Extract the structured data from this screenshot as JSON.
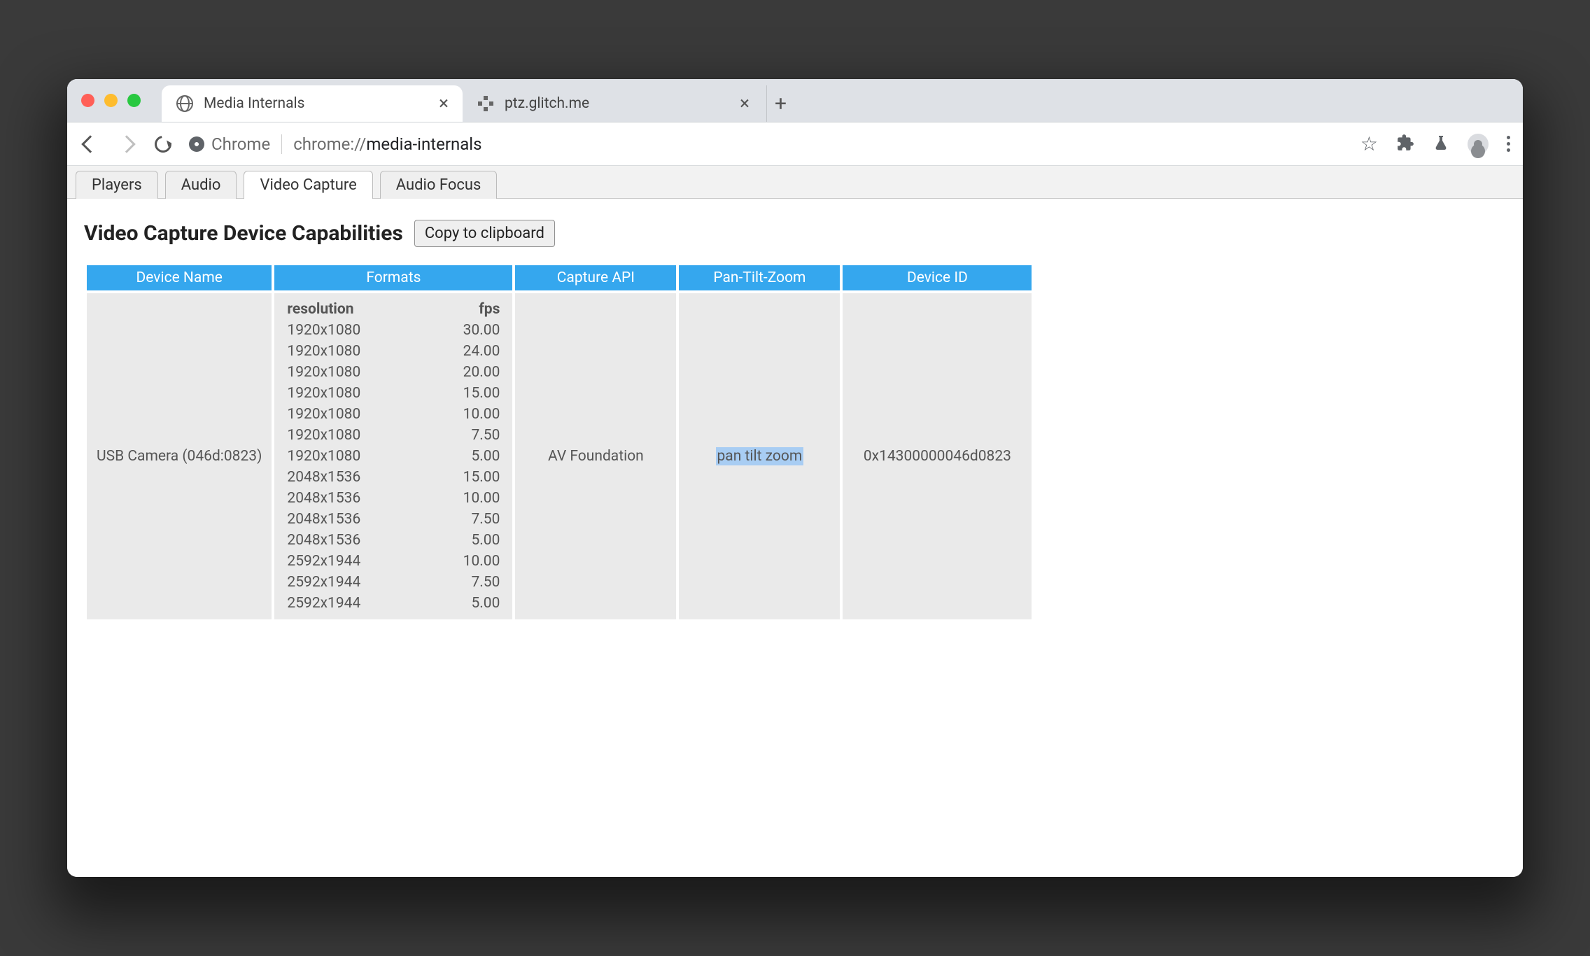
{
  "browser": {
    "tabs": [
      {
        "title": "Media Internals",
        "active": true,
        "icon": "globe"
      },
      {
        "title": "ptz.glitch.me",
        "active": false,
        "icon": "ptz"
      }
    ],
    "omnibox": {
      "origin_label": "Chrome",
      "scheme": "chrome://",
      "path": "media-internals"
    }
  },
  "page": {
    "subtabs": [
      "Players",
      "Audio",
      "Video Capture",
      "Audio Focus"
    ],
    "active_subtab": "Video Capture",
    "heading": "Video Capture Device Capabilities",
    "copy_button": "Copy to clipboard",
    "columns": [
      "Device Name",
      "Formats",
      "Capture API",
      "Pan-Tilt-Zoom",
      "Device ID"
    ],
    "device": {
      "name": "USB Camera (046d:0823)",
      "capture_api": "AV Foundation",
      "ptz": "pan tilt zoom",
      "id": "0x14300000046d0823",
      "format_headers": {
        "res": "resolution",
        "fps": "fps"
      },
      "formats": [
        {
          "res": "1920x1080",
          "fps": "30.00"
        },
        {
          "res": "1920x1080",
          "fps": "24.00"
        },
        {
          "res": "1920x1080",
          "fps": "20.00"
        },
        {
          "res": "1920x1080",
          "fps": "15.00"
        },
        {
          "res": "1920x1080",
          "fps": "10.00"
        },
        {
          "res": "1920x1080",
          "fps": "7.50"
        },
        {
          "res": "1920x1080",
          "fps": "5.00"
        },
        {
          "res": "2048x1536",
          "fps": "15.00"
        },
        {
          "res": "2048x1536",
          "fps": "10.00"
        },
        {
          "res": "2048x1536",
          "fps": "7.50"
        },
        {
          "res": "2048x1536",
          "fps": "5.00"
        },
        {
          "res": "2592x1944",
          "fps": "10.00"
        },
        {
          "res": "2592x1944",
          "fps": "7.50"
        },
        {
          "res": "2592x1944",
          "fps": "5.00"
        }
      ]
    }
  }
}
